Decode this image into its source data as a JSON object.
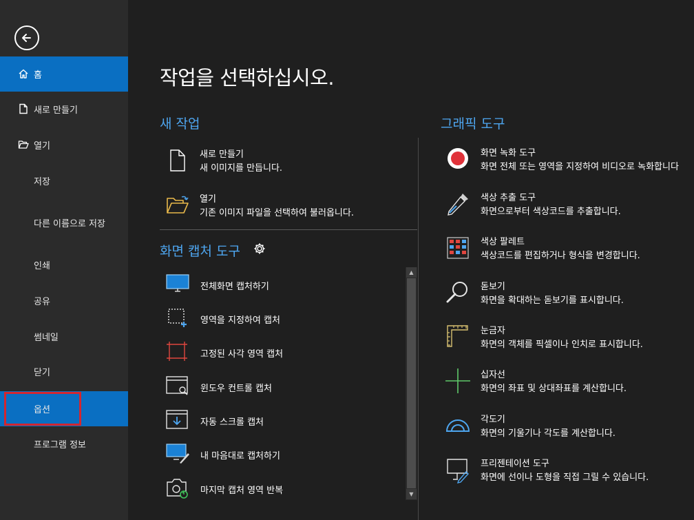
{
  "sidebar": {
    "items": [
      {
        "label": "홈",
        "icon": "home-icon"
      },
      {
        "label": "새로 만들기",
        "icon": "new-file-icon"
      },
      {
        "label": "열기",
        "icon": "open-folder-icon"
      },
      {
        "label": "저장"
      },
      {
        "label": "다른 이름으로 저장"
      },
      {
        "label": "인쇄"
      },
      {
        "label": "공유"
      },
      {
        "label": "썸네일"
      },
      {
        "label": "닫기"
      },
      {
        "label": "옵션"
      },
      {
        "label": "프로그램 정보"
      }
    ]
  },
  "main": {
    "title": "작업을 선택하십시오.",
    "new_task": {
      "title": "새 작업",
      "items": [
        {
          "title": "새로 만들기",
          "desc": "새 이미지를 만듭니다.",
          "icon": "blank-document-icon"
        },
        {
          "title": "열기",
          "desc": "기존 이미지 파일을 선택하여 불러옵니다.",
          "icon": "open-folder-icon"
        }
      ]
    },
    "capture_tools": {
      "title": "화면 캡처 도구",
      "items": [
        {
          "label": "전체화면 캡처하기",
          "icon": "monitor-icon"
        },
        {
          "label": "영역을 지정하여 캡처",
          "icon": "region-select-icon"
        },
        {
          "label": "고정된 사각 영역 캡처",
          "icon": "fixed-rectangle-icon"
        },
        {
          "label": "윈도우 컨트롤 캡처",
          "icon": "window-magnifier-icon"
        },
        {
          "label": "자동 스크롤 캡처",
          "icon": "scroll-down-icon"
        },
        {
          "label": "내 마음대로 캡처하기",
          "icon": "freehand-pen-icon"
        },
        {
          "label": "마지막 캡처 영역 반복",
          "icon": "repeat-camera-icon"
        }
      ]
    },
    "graphic_tools": {
      "title": "그래픽 도구",
      "items": [
        {
          "title": "화면 녹화 도구",
          "desc": "화면 전체 또는 영역을 지정하여 비디오로 녹화합니다",
          "icon": "record-icon"
        },
        {
          "title": "색상 추출 도구",
          "desc": "화면으로부터 색상코드를 추출합니다.",
          "icon": "eyedropper-icon"
        },
        {
          "title": "색상 팔레트",
          "desc": "색상코드를 편집하거나 형식을 변경합니다.",
          "icon": "palette-grid-icon"
        },
        {
          "title": "돋보기",
          "desc": "화면을 확대하는 돋보기를 표시합니다.",
          "icon": "magnifier-icon"
        },
        {
          "title": "눈금자",
          "desc": "화면의 객체를 픽셀이나 인치로 표시합니다.",
          "icon": "ruler-icon"
        },
        {
          "title": "십자선",
          "desc": "화면의 좌표 및 상대좌표를 계산합니다.",
          "icon": "crosshair-icon"
        },
        {
          "title": "각도기",
          "desc": "화면의 기울기나 각도를 계산합니다.",
          "icon": "protractor-icon"
        },
        {
          "title": "프리젠테이션 도구",
          "desc": "화면에 선이나 도형을 직접 그릴 수 있습니다.",
          "icon": "presentation-pen-icon"
        }
      ]
    }
  },
  "colors": {
    "accent": "#0a6fc2",
    "section_title": "#4ea6f0",
    "highlight_outline": "#d4262f",
    "sidebar_bg": "#2b2b2b",
    "main_bg": "#1f1f1f"
  }
}
